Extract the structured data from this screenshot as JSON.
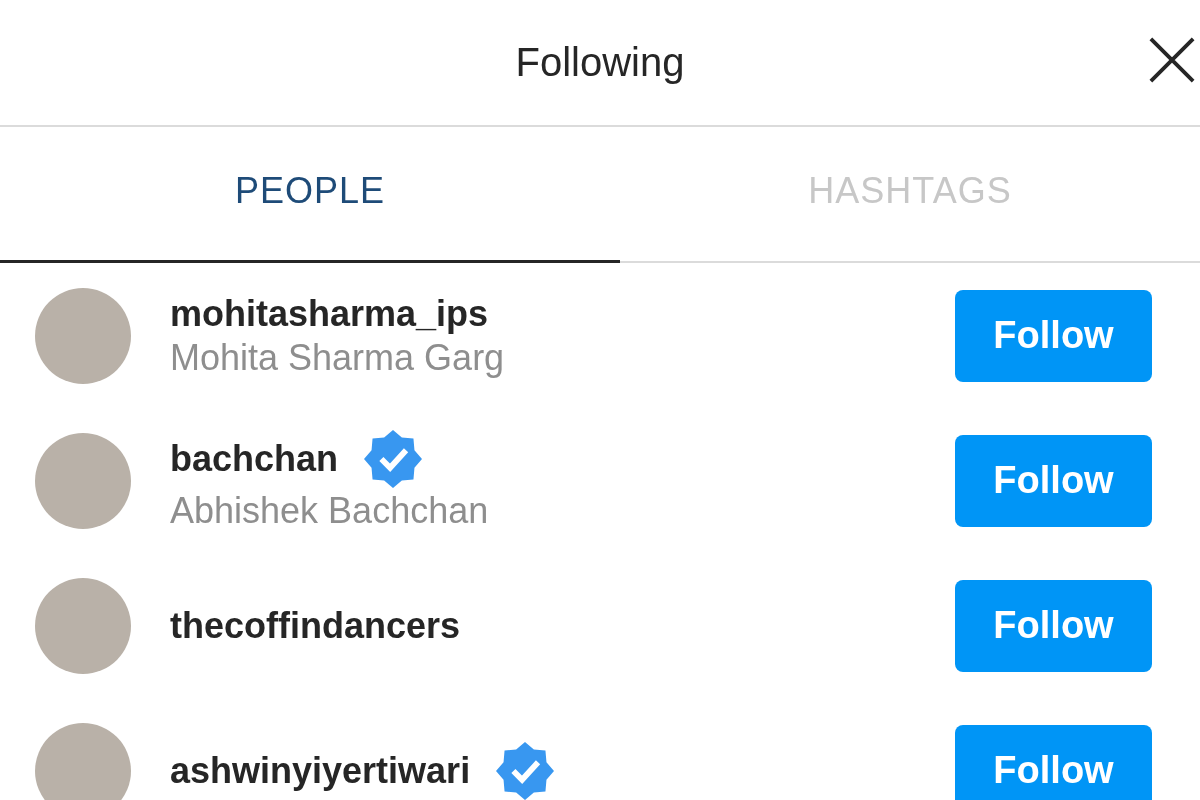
{
  "dialog": {
    "title": "Following"
  },
  "tabs": [
    {
      "label": "PEOPLE",
      "selected": true
    },
    {
      "label": "HASHTAGS",
      "selected": false
    }
  ],
  "users": [
    {
      "username": "mohitasharma_ips",
      "name": "Mohita Sharma Garg",
      "verified": false,
      "button": "Follow"
    },
    {
      "username": "bachchan",
      "name": "Abhishek Bachchan",
      "verified": true,
      "button": "Follow"
    },
    {
      "username": "thecoffindancers",
      "verified": false,
      "button": "Follow"
    },
    {
      "username": "ashwinyiyertiwari",
      "verified": true,
      "button": "Follow"
    }
  ]
}
